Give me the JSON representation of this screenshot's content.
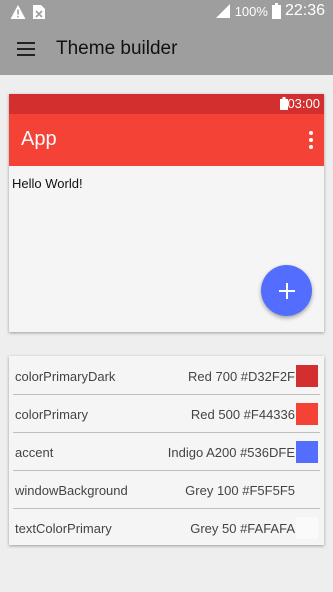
{
  "status_bar": {
    "battery_percent": "100%",
    "time": "22:36",
    "icons": [
      "warning-icon",
      "sim-card-icon",
      "signal-icon",
      "battery-icon"
    ]
  },
  "app_bar": {
    "title": "Theme builder",
    "menu_icon": "hamburger-menu-icon"
  },
  "preview": {
    "status_time": "03:00",
    "toolbar_title": "App",
    "body_text": "Hello World!",
    "fab_icon": "plus-icon",
    "overflow_icon": "more-vertical-icon"
  },
  "colors": [
    {
      "name": "colorPrimaryDark",
      "value": "Red 700 #D32F2F",
      "hex": "#D32F2F"
    },
    {
      "name": "colorPrimary",
      "value": "Red 500 #F44336",
      "hex": "#F44336"
    },
    {
      "name": "accent",
      "value": "Indigo A200 #536DFE",
      "hex": "#536DFE"
    },
    {
      "name": "windowBackground",
      "value": "Grey 100 #F5F5F5",
      "hex": "#F5F5F5"
    },
    {
      "name": "textColorPrimary",
      "value": "Grey 50 #FAFAFA",
      "hex": "#FAFAFA"
    }
  ]
}
